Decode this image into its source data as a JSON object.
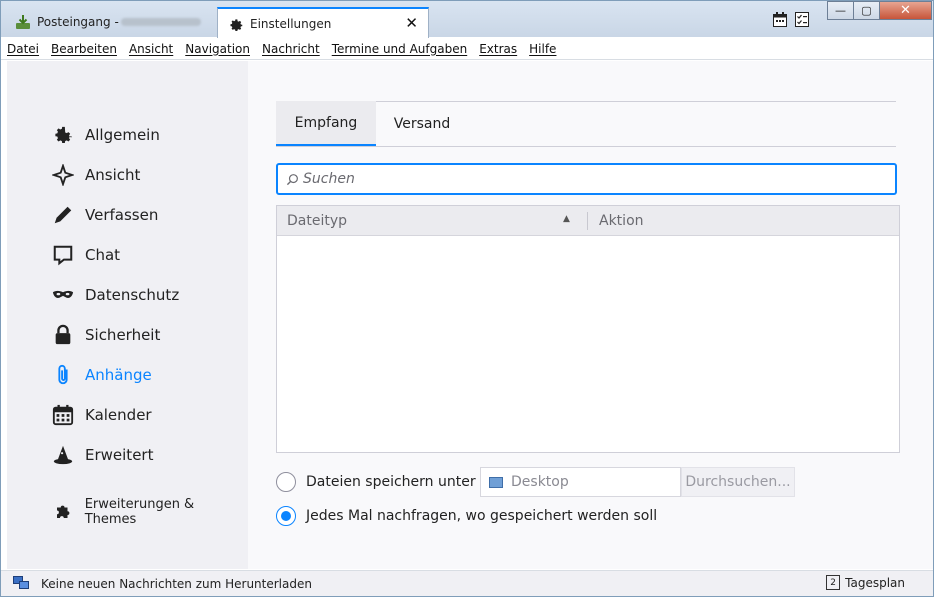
{
  "tabs": {
    "inbox_label": "Posteingang -",
    "settings_label": "Einstellungen",
    "close_glyph": "✕"
  },
  "window_controls": {
    "minimize": "—",
    "maximize": "▢",
    "close": "✕"
  },
  "menu": [
    "Datei",
    "Bearbeiten",
    "Ansicht",
    "Navigation",
    "Nachricht",
    "Termine und Aufgaben",
    "Extras",
    "Hilfe"
  ],
  "sidebar": {
    "items": [
      {
        "label": "Allgemein",
        "icon": "gear-icon"
      },
      {
        "label": "Ansicht",
        "icon": "sparkle-icon"
      },
      {
        "label": "Verfassen",
        "icon": "pencil-icon"
      },
      {
        "label": "Chat",
        "icon": "chat-bubble-icon"
      },
      {
        "label": "Datenschutz",
        "icon": "mask-icon"
      },
      {
        "label": "Sicherheit",
        "icon": "lock-icon"
      },
      {
        "label": "Anhänge",
        "icon": "paperclip-icon"
      },
      {
        "label": "Kalender",
        "icon": "calendar-icon"
      },
      {
        "label": "Erweitert",
        "icon": "wizard-hat-icon"
      }
    ],
    "active_index": 6,
    "extensions_label": "Erweiterungen & Themes"
  },
  "pane": {
    "tabs": [
      "Empfang",
      "Versand"
    ],
    "selected_tab": "Empfang",
    "search_placeholder": "Suchen",
    "table": {
      "col_filetype": "Dateityp",
      "col_action": "Aktion",
      "rows": []
    },
    "save_option_label": "Dateien speichern unter",
    "save_path": "Desktop",
    "browse_label": "Durchsuchen...",
    "ask_option_label": "Jedes Mal nachfragen, wo gespeichert werden soll",
    "selected_option": "ask"
  },
  "status": {
    "message": "Keine neuen Nachrichten zum Herunterladen",
    "today_pane_label": "Tagesplan",
    "today_number": "2"
  },
  "colors": {
    "accent": "#0a84ff"
  }
}
